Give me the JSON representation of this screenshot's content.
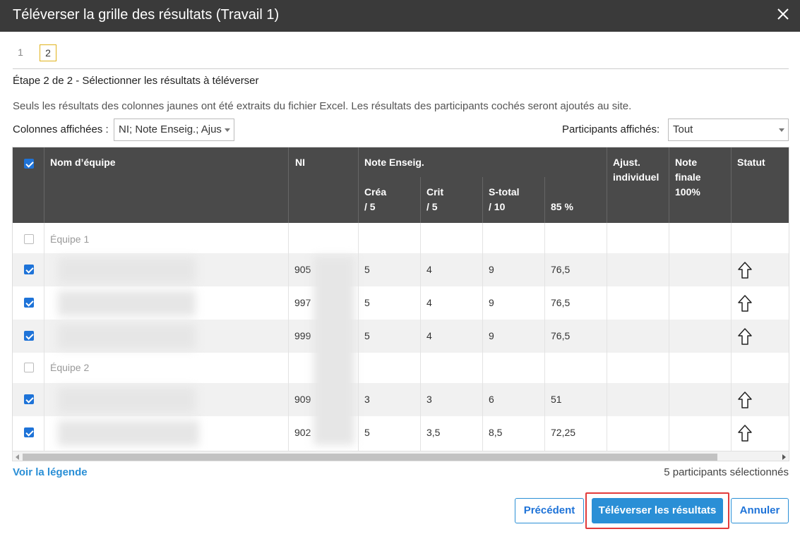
{
  "dialog": {
    "title": "Téléverser la grille des résultats (Travail 1)",
    "close_icon": "close-icon"
  },
  "steps": {
    "items": [
      "1",
      "2"
    ],
    "current": "2",
    "step_title": "Étape 2 de 2 - Sélectionner les résultats à téléverser",
    "description": "Seuls les résultats des colonnes jaunes ont été extraits du fichier Excel. Les résultats des participants cochés seront ajoutés au site."
  },
  "filters": {
    "columns_label": "Colonnes affichées :",
    "columns_value": "NI; Note Enseig.; Ajus",
    "participants_label": "Participants affichés:",
    "participants_value": "Tout"
  },
  "table": {
    "headers": {
      "team": "Nom d’équipe",
      "ni": "NI",
      "note_group": "Note Enseig.",
      "crea": [
        "Créa",
        "/ 5"
      ],
      "crit": [
        "Crit",
        "/ 5"
      ],
      "stotal": [
        "S-total",
        "/ 10"
      ],
      "pct": "85 %",
      "ajust": [
        "Ajust.",
        "individuel"
      ],
      "finale": [
        "Note",
        "finale",
        "100%"
      ],
      "statut": "Statut"
    },
    "rows": [
      {
        "type": "group",
        "name": "Équipe 1",
        "checked": false
      },
      {
        "type": "member",
        "checked": true,
        "ni": "905",
        "crea": "5",
        "crit": "4",
        "stotal": "9",
        "pct": "76,5",
        "status_icon": "upload-arrow-icon"
      },
      {
        "type": "member",
        "checked": true,
        "ni": "997",
        "crea": "5",
        "crit": "4",
        "stotal": "9",
        "pct": "76,5",
        "status_icon": "upload-arrow-icon"
      },
      {
        "type": "member",
        "checked": true,
        "ni": "999",
        "crea": "5",
        "crit": "4",
        "stotal": "9",
        "pct": "76,5",
        "status_icon": "upload-arrow-icon"
      },
      {
        "type": "group",
        "name": "Équipe 2",
        "checked": false
      },
      {
        "type": "member",
        "checked": true,
        "ni": "909",
        "crea": "3",
        "crit": "3",
        "stotal": "6",
        "pct": "51",
        "status_icon": "upload-arrow-icon"
      },
      {
        "type": "member",
        "checked": true,
        "ni": "902",
        "crea": "5",
        "crit": "3,5",
        "stotal": "8,5",
        "pct": "72,25",
        "status_icon": "upload-arrow-icon"
      }
    ]
  },
  "footer": {
    "legend_link": "Voir la légende",
    "selected_count": "5 participants sélectionnés",
    "prev_label": "Précédent",
    "upload_label": "Téléverser les résultats",
    "cancel_label": "Annuler"
  },
  "colors": {
    "title_bar": "#3a3a3a",
    "header_bg": "#4a4a4a",
    "accent": "#2a8fd6",
    "step_highlight": "#e0b31c",
    "highlight_frame": "#e23b3b"
  }
}
